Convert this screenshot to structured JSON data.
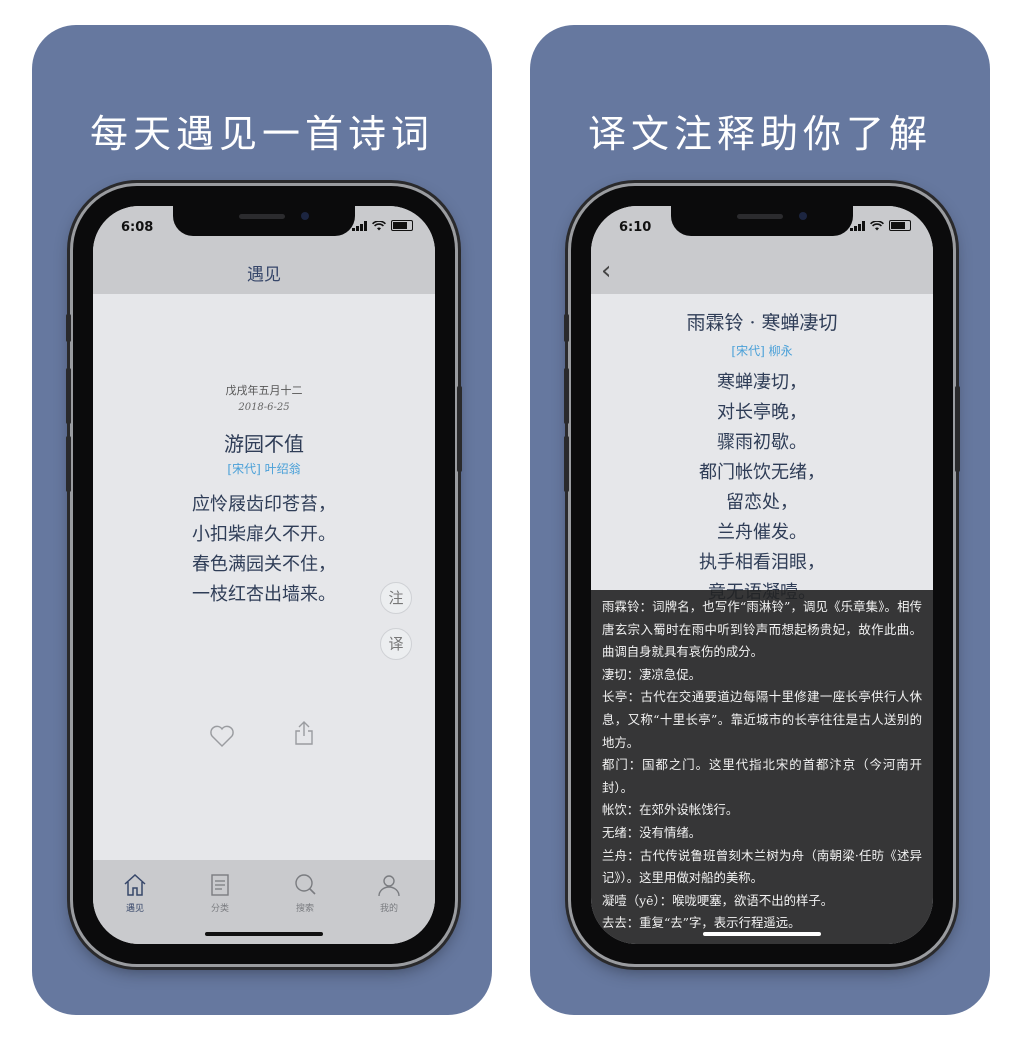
{
  "left": {
    "headline": "每天遇见一首诗词",
    "status_time": "6:08",
    "nav_title": "遇见",
    "lunar_date": "戊戌年五月十二",
    "date": "2018-6-25",
    "poem_title": "游园不值",
    "dynasty": "[宋代]",
    "author": "叶绍翁",
    "lines": [
      "应怜屐齿印苍苔，",
      "小扣柴扉久不开。",
      "春色满园关不住，",
      "一枝红杏出墙来。"
    ],
    "side_notes": "注",
    "side_translate": "译",
    "tabs": [
      {
        "label": "遇见",
        "icon": "home-icon"
      },
      {
        "label": "分类",
        "icon": "book-icon"
      },
      {
        "label": "搜索",
        "icon": "search-icon"
      },
      {
        "label": "我的",
        "icon": "profile-icon"
      }
    ],
    "accent": "#37476a",
    "link_color": "#4aa0d8"
  },
  "right": {
    "headline": "译文注释助你了解",
    "status_time": "6:10",
    "poem_title": "雨霖铃 · 寒蝉凄切",
    "dynasty": "[宋代]",
    "author": "柳永",
    "lines": [
      "寒蝉凄切，",
      "对长亭晚，",
      "骤雨初歇。",
      "都门帐饮无绪，",
      "留恋处，",
      "兰舟催发。",
      "执手相看泪眼，",
      "竟无语凝噎。"
    ],
    "notes": [
      "雨霖铃：词牌名，也写作“雨淋铃”，调见《乐章集》。相传唐玄宗入蜀时在雨中听到铃声而想起杨贵妃，故作此曲。曲调自身就具有哀伤的成分。",
      "凄切：凄凉急促。",
      "长亭：古代在交通要道边每隔十里修建一座长亭供行人休息，又称“十里长亭”。靠近城市的长亭往往是古人送别的地方。",
      "都门：国都之门。这里代指北宋的首都汴京（今河南开封）。",
      "帐饮：在郊外设帐饯行。",
      "无绪：没有情绪。",
      "兰舟：古代传说鲁班曾刻木兰树为舟（南朝梁·任昉《述异记》）。这里用做对船的美称。",
      "凝噎（yē）：喉咙哽塞，欲语不出的样子。",
      "去去：重复“去”字，表示行程遥远。"
    ]
  }
}
